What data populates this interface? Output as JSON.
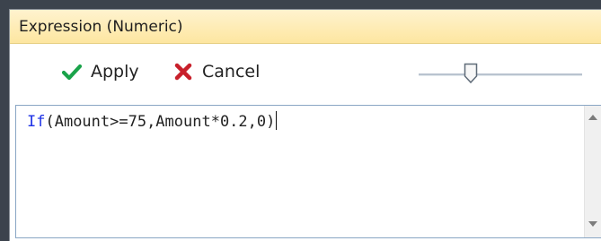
{
  "window": {
    "title": "Expression (Numeric)"
  },
  "toolbar": {
    "apply_label": "Apply",
    "cancel_label": "Cancel",
    "apply_icon": "check-icon",
    "cancel_icon": "x-icon",
    "apply_color": "#1aa34a",
    "cancel_color": "#c8202b",
    "slider_level": 0.3
  },
  "editor": {
    "keyword": "If",
    "expression_rest": "(Amount>=75,Amount*0.2,0)",
    "keyword_color": "#1d31e6"
  }
}
